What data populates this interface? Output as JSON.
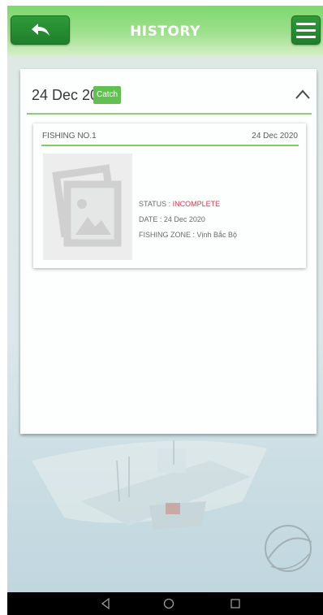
{
  "header": {
    "title": "HISTORY",
    "back_icon": "back-arrow-icon",
    "menu_icon": "hamburger-menu-icon"
  },
  "group": {
    "date": "24 Dec 20",
    "badge": "Catch",
    "toggle_icon": "chevron-up-icon"
  },
  "trip": {
    "title": "FISHING NO.1",
    "date": "24 Dec 2020",
    "status_label": "STATUS : ",
    "status_value": "INCOMPLETE",
    "date_line": "DATE : 24 Dec 2020",
    "zone_line": "FISHING ZONE : Vịnh Bắc Bộ",
    "thumbnail_icon": "image-placeholder-icon"
  },
  "nav": {
    "back_icon": "nav-back-icon",
    "home_icon": "nav-home-icon",
    "recents_icon": "nav-recents-icon"
  },
  "colors": {
    "accent_green": "#5cc04d",
    "button_green": "#2f9a3a",
    "status_red": "#e0314b"
  }
}
